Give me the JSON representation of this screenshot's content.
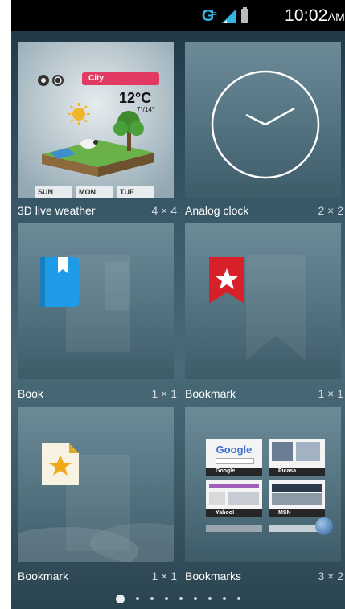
{
  "status_bar": {
    "network_label": "G",
    "network_sub": "E",
    "time": "10:02",
    "ampm": "AM",
    "accent_color": "#33b5e5"
  },
  "widgets": [
    {
      "label": "3D live weather",
      "size": "4 × 4"
    },
    {
      "label": "Analog clock",
      "size": "2 × 2"
    },
    {
      "label": "Book",
      "size": "1 × 1"
    },
    {
      "label": "Bookmark",
      "size": "1 × 1"
    },
    {
      "label": "Bookmark",
      "size": "1 × 1"
    },
    {
      "label": "Bookmarks",
      "size": "3 × 2"
    }
  ],
  "weather_preview": {
    "city": "City",
    "temperature": "12°C",
    "range": "7°/14°",
    "days": [
      "SUN",
      "MON",
      "TUE"
    ]
  },
  "bookmarks_preview": {
    "sites": [
      "Google",
      "Picasa",
      "Yahoo!",
      "MSN"
    ],
    "google_logo_text": "Google"
  },
  "page_indicator": {
    "count": 9,
    "active": 1
  }
}
